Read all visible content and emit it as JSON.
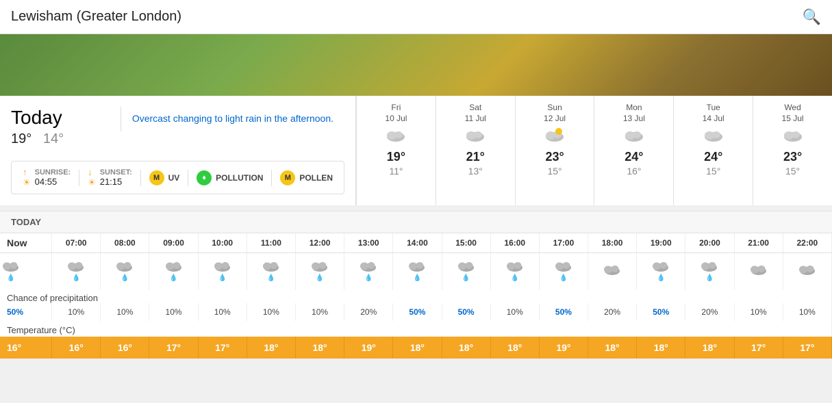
{
  "header": {
    "title": "Lewisham (Greater London)",
    "search_label": "search"
  },
  "today": {
    "label": "Today",
    "high": "19°",
    "low": "14°",
    "description": "Overcast changing to light rain in the afternoon.",
    "sunrise_label": "SUNRISE:",
    "sunrise_time": "04:55",
    "sunset_label": "SUNSET:",
    "sunset_time": "21:15",
    "uv_label": "UV",
    "uv_badge": "M",
    "pollution_label": "POLLUTION",
    "pollen_label": "POLLEN"
  },
  "forecast": [
    {
      "day": "Fri",
      "date": "10 Jul",
      "high": "19°",
      "low": "11°"
    },
    {
      "day": "Sat",
      "date": "11 Jul",
      "high": "21°",
      "low": "13°"
    },
    {
      "day": "Sun",
      "date": "12 Jul",
      "high": "23°",
      "low": "15°"
    },
    {
      "day": "Mon",
      "date": "13 Jul",
      "high": "24°",
      "low": "16°"
    },
    {
      "day": "Tue",
      "date": "14 Jul",
      "high": "24°",
      "low": "15°"
    },
    {
      "day": "Wed",
      "date": "15 Jul",
      "high": "23°",
      "low": "15°"
    }
  ],
  "hourly": {
    "section_label": "TODAY",
    "times": [
      "Now",
      "07:00",
      "08:00",
      "09:00",
      "10:00",
      "11:00",
      "12:00",
      "13:00",
      "14:00",
      "15:00",
      "16:00",
      "17:00",
      "18:00",
      "19:00",
      "20:00",
      "21:00",
      "22:00"
    ],
    "weather_types": [
      "rain",
      "rain",
      "rain",
      "rain",
      "rain",
      "rain",
      "rain",
      "rain",
      "rain",
      "rain",
      "rain",
      "rain",
      "cloud",
      "rain",
      "rain",
      "cloud",
      "cloud"
    ],
    "precip_label": "Chance of precipitation",
    "precip_values": [
      "50%",
      "10%",
      "10%",
      "10%",
      "10%",
      "10%",
      "10%",
      "20%",
      "50%",
      "50%",
      "10%",
      "50%",
      "20%",
      "50%",
      "20%",
      "10%",
      "10%"
    ],
    "precip_high": [
      true,
      false,
      false,
      false,
      false,
      false,
      false,
      false,
      true,
      true,
      false,
      true,
      false,
      true,
      false,
      false,
      false
    ],
    "temp_label": "Temperature (°C)",
    "temps": [
      "16°",
      "16°",
      "16°",
      "17°",
      "17°",
      "18°",
      "18°",
      "19°",
      "18°",
      "18°",
      "18°",
      "19°",
      "18°",
      "18°",
      "18°",
      "17°",
      "17°"
    ]
  },
  "colors": {
    "accent_blue": "#0066cc",
    "temp_bg": "#f5a623",
    "low_temp": "#888888"
  }
}
